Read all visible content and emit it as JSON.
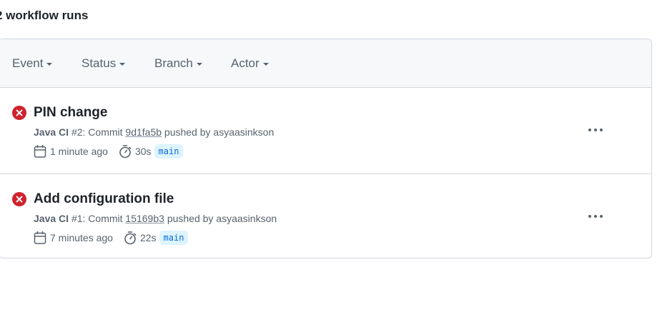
{
  "header": {
    "runs_count": "2 workflow runs"
  },
  "filters": [
    {
      "label": "Event"
    },
    {
      "label": "Status"
    },
    {
      "label": "Branch"
    },
    {
      "label": "Actor"
    }
  ],
  "runs": [
    {
      "title": "PIN change",
      "workflow": "Java CI",
      "run_number": "#2",
      "commit_prefix": ": Commit",
      "commit_sha": "9d1fa5b",
      "pushed_by": "pushed by asyaasinkson",
      "time_ago": "1 minute ago",
      "duration": "30s",
      "branch": "main",
      "status": "failure"
    },
    {
      "title": "Add configuration file",
      "workflow": "Java CI",
      "run_number": "#1",
      "commit_prefix": ": Commit",
      "commit_sha": "15169b3",
      "pushed_by": "pushed by asyaasinkson",
      "time_ago": "7 minutes ago",
      "duration": "22s",
      "branch": "main",
      "status": "failure"
    }
  ],
  "colors": {
    "failure": "#cf222e",
    "branch_bg": "#ddf4ff",
    "branch_fg": "#0969da",
    "muted": "#59636e",
    "border": "#d0d7de"
  },
  "icons": {
    "status": "x-circle-fill-icon",
    "time": "calendar-icon",
    "duration": "stopwatch-icon",
    "menu": "kebab-horizontal-icon",
    "filter_caret": "triangle-down-icon"
  }
}
